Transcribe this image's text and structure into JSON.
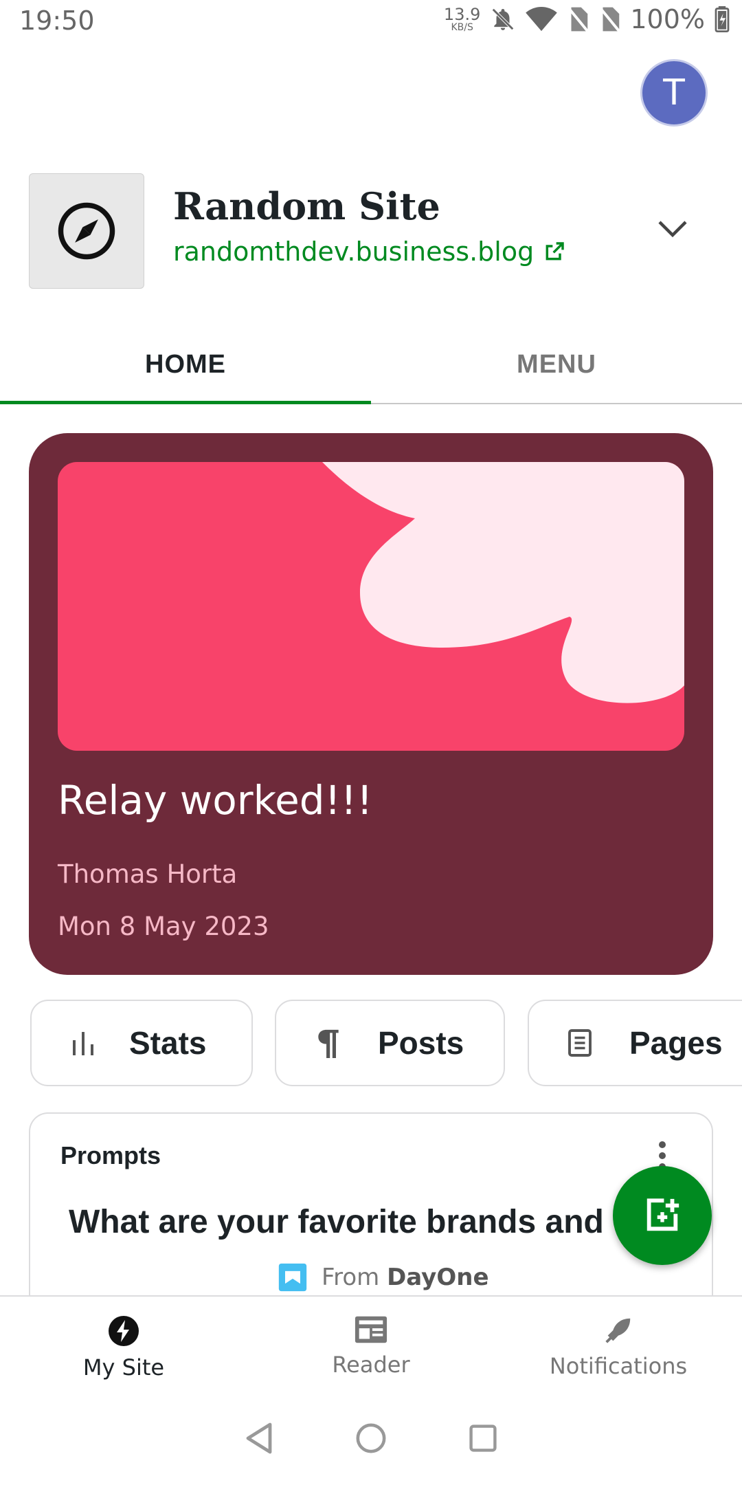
{
  "status_bar": {
    "time": "19:50",
    "net_speed": "13.9",
    "net_unit": "KB/S",
    "battery": "100%",
    "icons": [
      "bell-off-icon",
      "wifi-icon",
      "no-sim-icon",
      "no-sim-icon",
      "battery-icon"
    ]
  },
  "account": {
    "avatar_letter": "T",
    "avatar_color": "#5c6bc0"
  },
  "site": {
    "title": "Random Site",
    "url": "randomthdev.business.blog",
    "icon": "compass-icon"
  },
  "tabs": [
    {
      "label": "HOME",
      "active": true
    },
    {
      "label": "MENU",
      "active": false
    }
  ],
  "post_card": {
    "title": "Relay worked!!!",
    "author": "Thomas Horta",
    "date": "Mon 8 May 2023",
    "bg_color": "#6e2a3a",
    "image_color": "#f8436a"
  },
  "quick_actions": [
    {
      "label": "Stats",
      "icon": "stats-icon"
    },
    {
      "label": "Posts",
      "icon": "pilcrow-icon"
    },
    {
      "label": "Pages",
      "icon": "page-icon"
    }
  ],
  "prompts": {
    "title": "Prompts",
    "question": "What are your favorite brands and w",
    "from_prefix": "From",
    "from_source": "DayOne"
  },
  "fab": {
    "icon": "new-post-icon",
    "color": "#008a20"
  },
  "bottom_nav": [
    {
      "label": "My Site",
      "icon": "my-site-icon",
      "active": true
    },
    {
      "label": "Reader",
      "icon": "reader-icon",
      "active": false
    },
    {
      "label": "Notifications",
      "icon": "notifications-icon",
      "active": false
    }
  ],
  "accent_color": "#008a20"
}
